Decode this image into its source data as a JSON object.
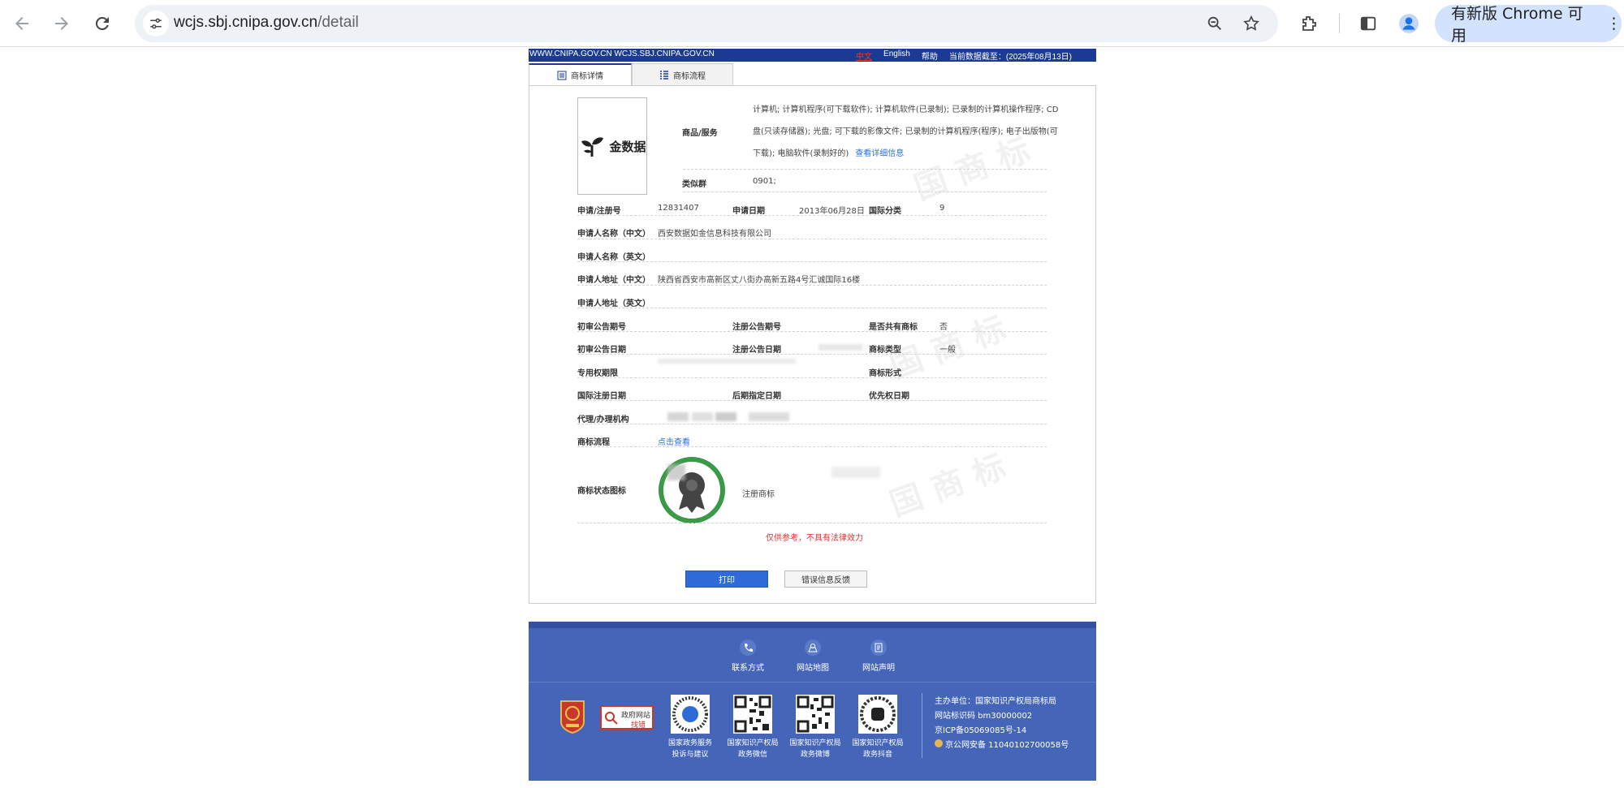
{
  "browser": {
    "url_host": "wcjs.sbj.cnipa.gov.cn",
    "url_path": "/detail",
    "update_label": "有新版 Chrome 可用"
  },
  "site": {
    "domains": "WWW.CNIPA.GOV.CN WCJS.SBJ.CNIPA.GOV.CN",
    "lang_zh": "中文",
    "lang_en": "English",
    "help": "帮助",
    "data_date": "当前数据截至：(2025年08月13日)"
  },
  "tabs": [
    {
      "label": "商标详情"
    },
    {
      "label": "商标流程"
    }
  ],
  "trademark": {
    "brand_text": "金数据",
    "labels": {
      "goods": "商品/服务",
      "similar_group": "类似群",
      "reg_no": "申请/注册号",
      "app_date": "申请日期",
      "intl_class": "国际分类",
      "applicant_cn": "申请人名称（中文）",
      "applicant_en": "申请人名称（英文）",
      "address_cn": "申请人地址（中文）",
      "address_en": "申请人地址（英文）",
      "prelim_no": "初审公告期号",
      "reg_pub_no": "注册公告期号",
      "shared": "是否共有商标",
      "prelim_date": "初审公告日期",
      "reg_pub_date": "注册公告日期",
      "tm_type": "商标类型",
      "exclusive_period": "专用权期限",
      "tm_form": "商标形式",
      "intl_reg_date": "国际注册日期",
      "later_designation": "后期指定日期",
      "priority_date": "优先权日期",
      "agent": "代理/办理机构",
      "process": "商标流程",
      "status_icon": "商标状态图标"
    },
    "goods_text": "计算机; 计算机程序(可下载软件); 计算机软件(已录制); 已录制的计算机操作程序; CD盘(只读存储器); 光盘; 可下载的影像文件; 已录制的计算机程序(程序); 电子出版物(可下载); 电脑软件(录制好的)",
    "goods_more": "查看详细信息",
    "similar_group": "0901;",
    "reg_no": "12831407",
    "app_date": "2013年06月28日",
    "intl_class": "9",
    "applicant_cn": "西安数据如金信息科技有限公司",
    "address_cn": "陕西省西安市高新区丈八街办高新五路4号汇诚国际16楼",
    "shared": "否",
    "tm_type": "一般",
    "process_link": "点击查看",
    "status_text": "注册商标",
    "disclaimer": "仅供参考，不具有法律效力",
    "print_btn": "打印",
    "error_btn": "错误信息反馈"
  },
  "footer": {
    "links": [
      {
        "label": "联系方式",
        "icon": "phone-icon"
      },
      {
        "label": "网站地图",
        "icon": "sitemap-icon"
      },
      {
        "label": "网站声明",
        "icon": "document-icon"
      }
    ],
    "badge_gov": "政府网站",
    "badge_error": "找错",
    "qrs": [
      {
        "line1": "国家政务服务",
        "line2": "投诉与建议"
      },
      {
        "line1": "国家知识产权局",
        "line2": "政务微信"
      },
      {
        "line1": "国家知识产权局",
        "line2": "政务微博"
      },
      {
        "line1": "国家知识产权局",
        "line2": "政务抖音"
      }
    ],
    "host": "主办单位：国家知识产权局商标局",
    "site_code": "网站标识码 bm30000002",
    "icp": "京ICP备05069085号-14",
    "police": "京公网安备 11040102700058号"
  }
}
